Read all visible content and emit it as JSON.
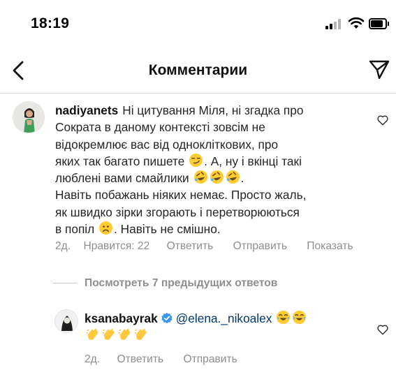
{
  "status_bar": {
    "time": "18:19"
  },
  "header": {
    "title": "Комментарии",
    "back_icon": "chevron-left-icon",
    "send_icon": "paper-plane-icon"
  },
  "comment": {
    "username": "nadiyanets",
    "text_part1": "Ні цитування Міля, ні згадка про",
    "text_line2": "Сократа в даному контексті зовсім не",
    "text_line3": "відокремлює вас від однокліткових, про",
    "text_line4": "яких так багато пишете",
    "text_line5a": ". А, ну і вкінці такі",
    "text_line6": "люблені вами смайлики",
    "text_line7": "Навіть побажань ніяких немає. Просто жаль,",
    "text_line8": "як швидко зірки згорають і перетворюються",
    "text_line9": "в попіл",
    "text_line9b": ". Навіть не смішно.",
    "meta": {
      "time": "2д.",
      "likes": "Нравится: 22",
      "reply": "Ответить",
      "send": "Отправить",
      "show": "Показать"
    }
  },
  "view_replies": "Посмотреть 7 предыдущих ответов",
  "reply": {
    "username": "ksanabayrak",
    "mention": "@elena._nikoalex",
    "meta": {
      "time": "2д.",
      "reply": "Ответить",
      "send": "Отправить"
    }
  },
  "colors": {
    "text": "#262626",
    "secondary": "#8e8e8e",
    "mention": "#00376b",
    "verified": "#3897f0",
    "divider": "#dbdbdb"
  }
}
